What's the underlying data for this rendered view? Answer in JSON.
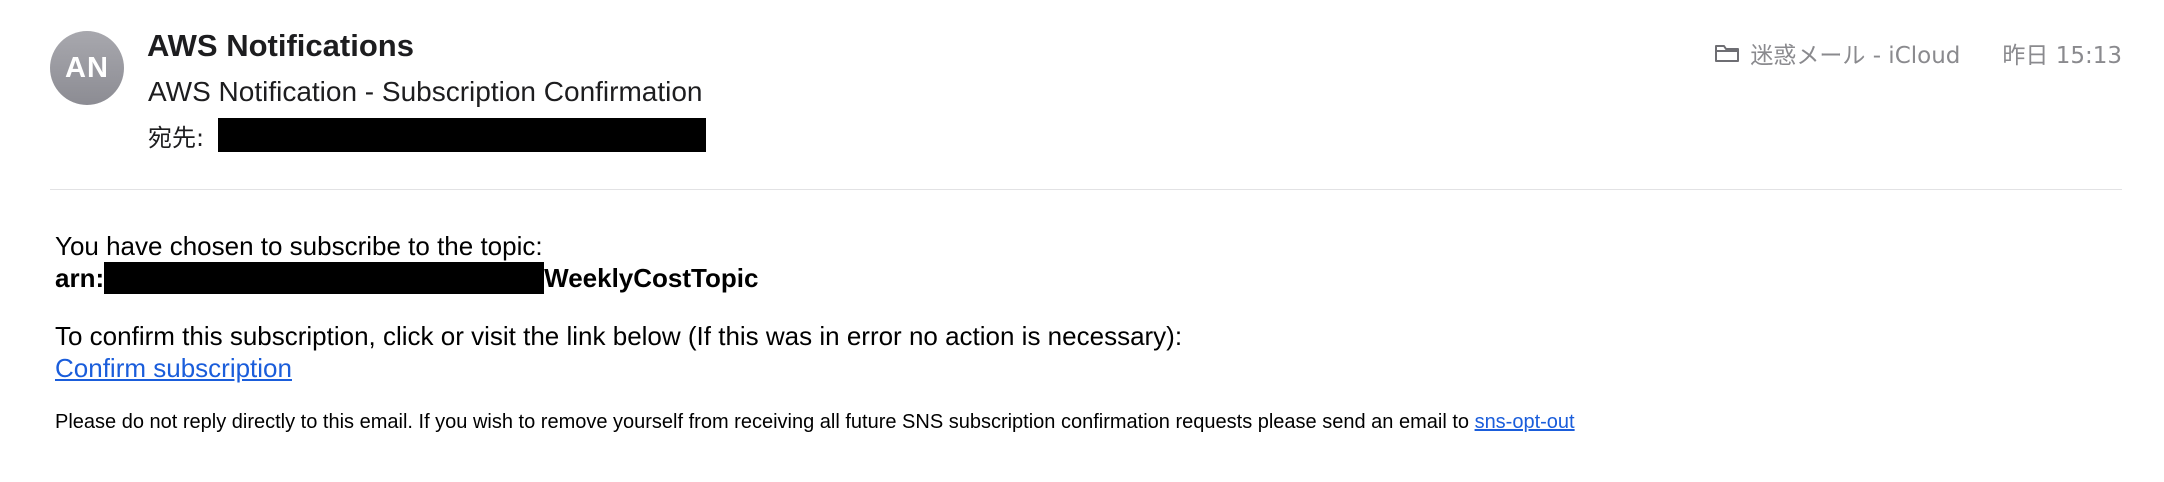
{
  "header": {
    "avatar_initials": "AN",
    "sender_name": "AWS Notifications",
    "subject": "AWS Notification - Subscription Confirmation",
    "to_label": "宛先:",
    "mailbox": "迷惑メール - iCloud",
    "mailbox_icon": "folder-icon",
    "date": "昨日 15:13"
  },
  "body": {
    "intro": "You have chosen to subscribe to the topic:",
    "arn_prefix": "arn:",
    "arn_suffix": "WeeklyCostTopic",
    "confirm_text": "To confirm this subscription, click or visit the link below (If this was in error no action is necessary):",
    "confirm_link": "Confirm subscription",
    "footer_text": "Please do not reply directly to this email. If you wish to remove yourself from receiving all future SNS subscription confirmation requests please send an email to ",
    "opt_out_link": "sns-opt-out"
  },
  "colors": {
    "link": "#1a5ddb",
    "avatar": "#9a9aa0",
    "meta_text": "#8a8a8e"
  }
}
